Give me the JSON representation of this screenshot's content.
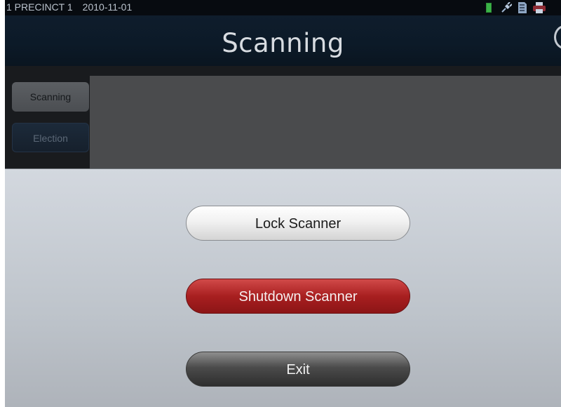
{
  "statusbar": {
    "precinct": "1 PRECINCT 1",
    "date": "2010-11-01",
    "icons": [
      "battery-icon",
      "connection-plug-icon",
      "memory-card-icon",
      "printer-icon"
    ]
  },
  "header": {
    "title": "Scanning",
    "help_icon": "help-icon"
  },
  "sidebar": {
    "items": [
      {
        "label": "Scanning",
        "state": "selected"
      },
      {
        "label": "Election",
        "state": "normal"
      }
    ]
  },
  "dialog": {
    "buttons": {
      "lock": "Lock Scanner",
      "shutdown": "Shutdown Scanner",
      "exit": "Exit"
    }
  },
  "colors": {
    "shutdown_button": "#a81f20",
    "title_bar": "#0f1d2c",
    "dialog_background": "#c8cdd3"
  }
}
